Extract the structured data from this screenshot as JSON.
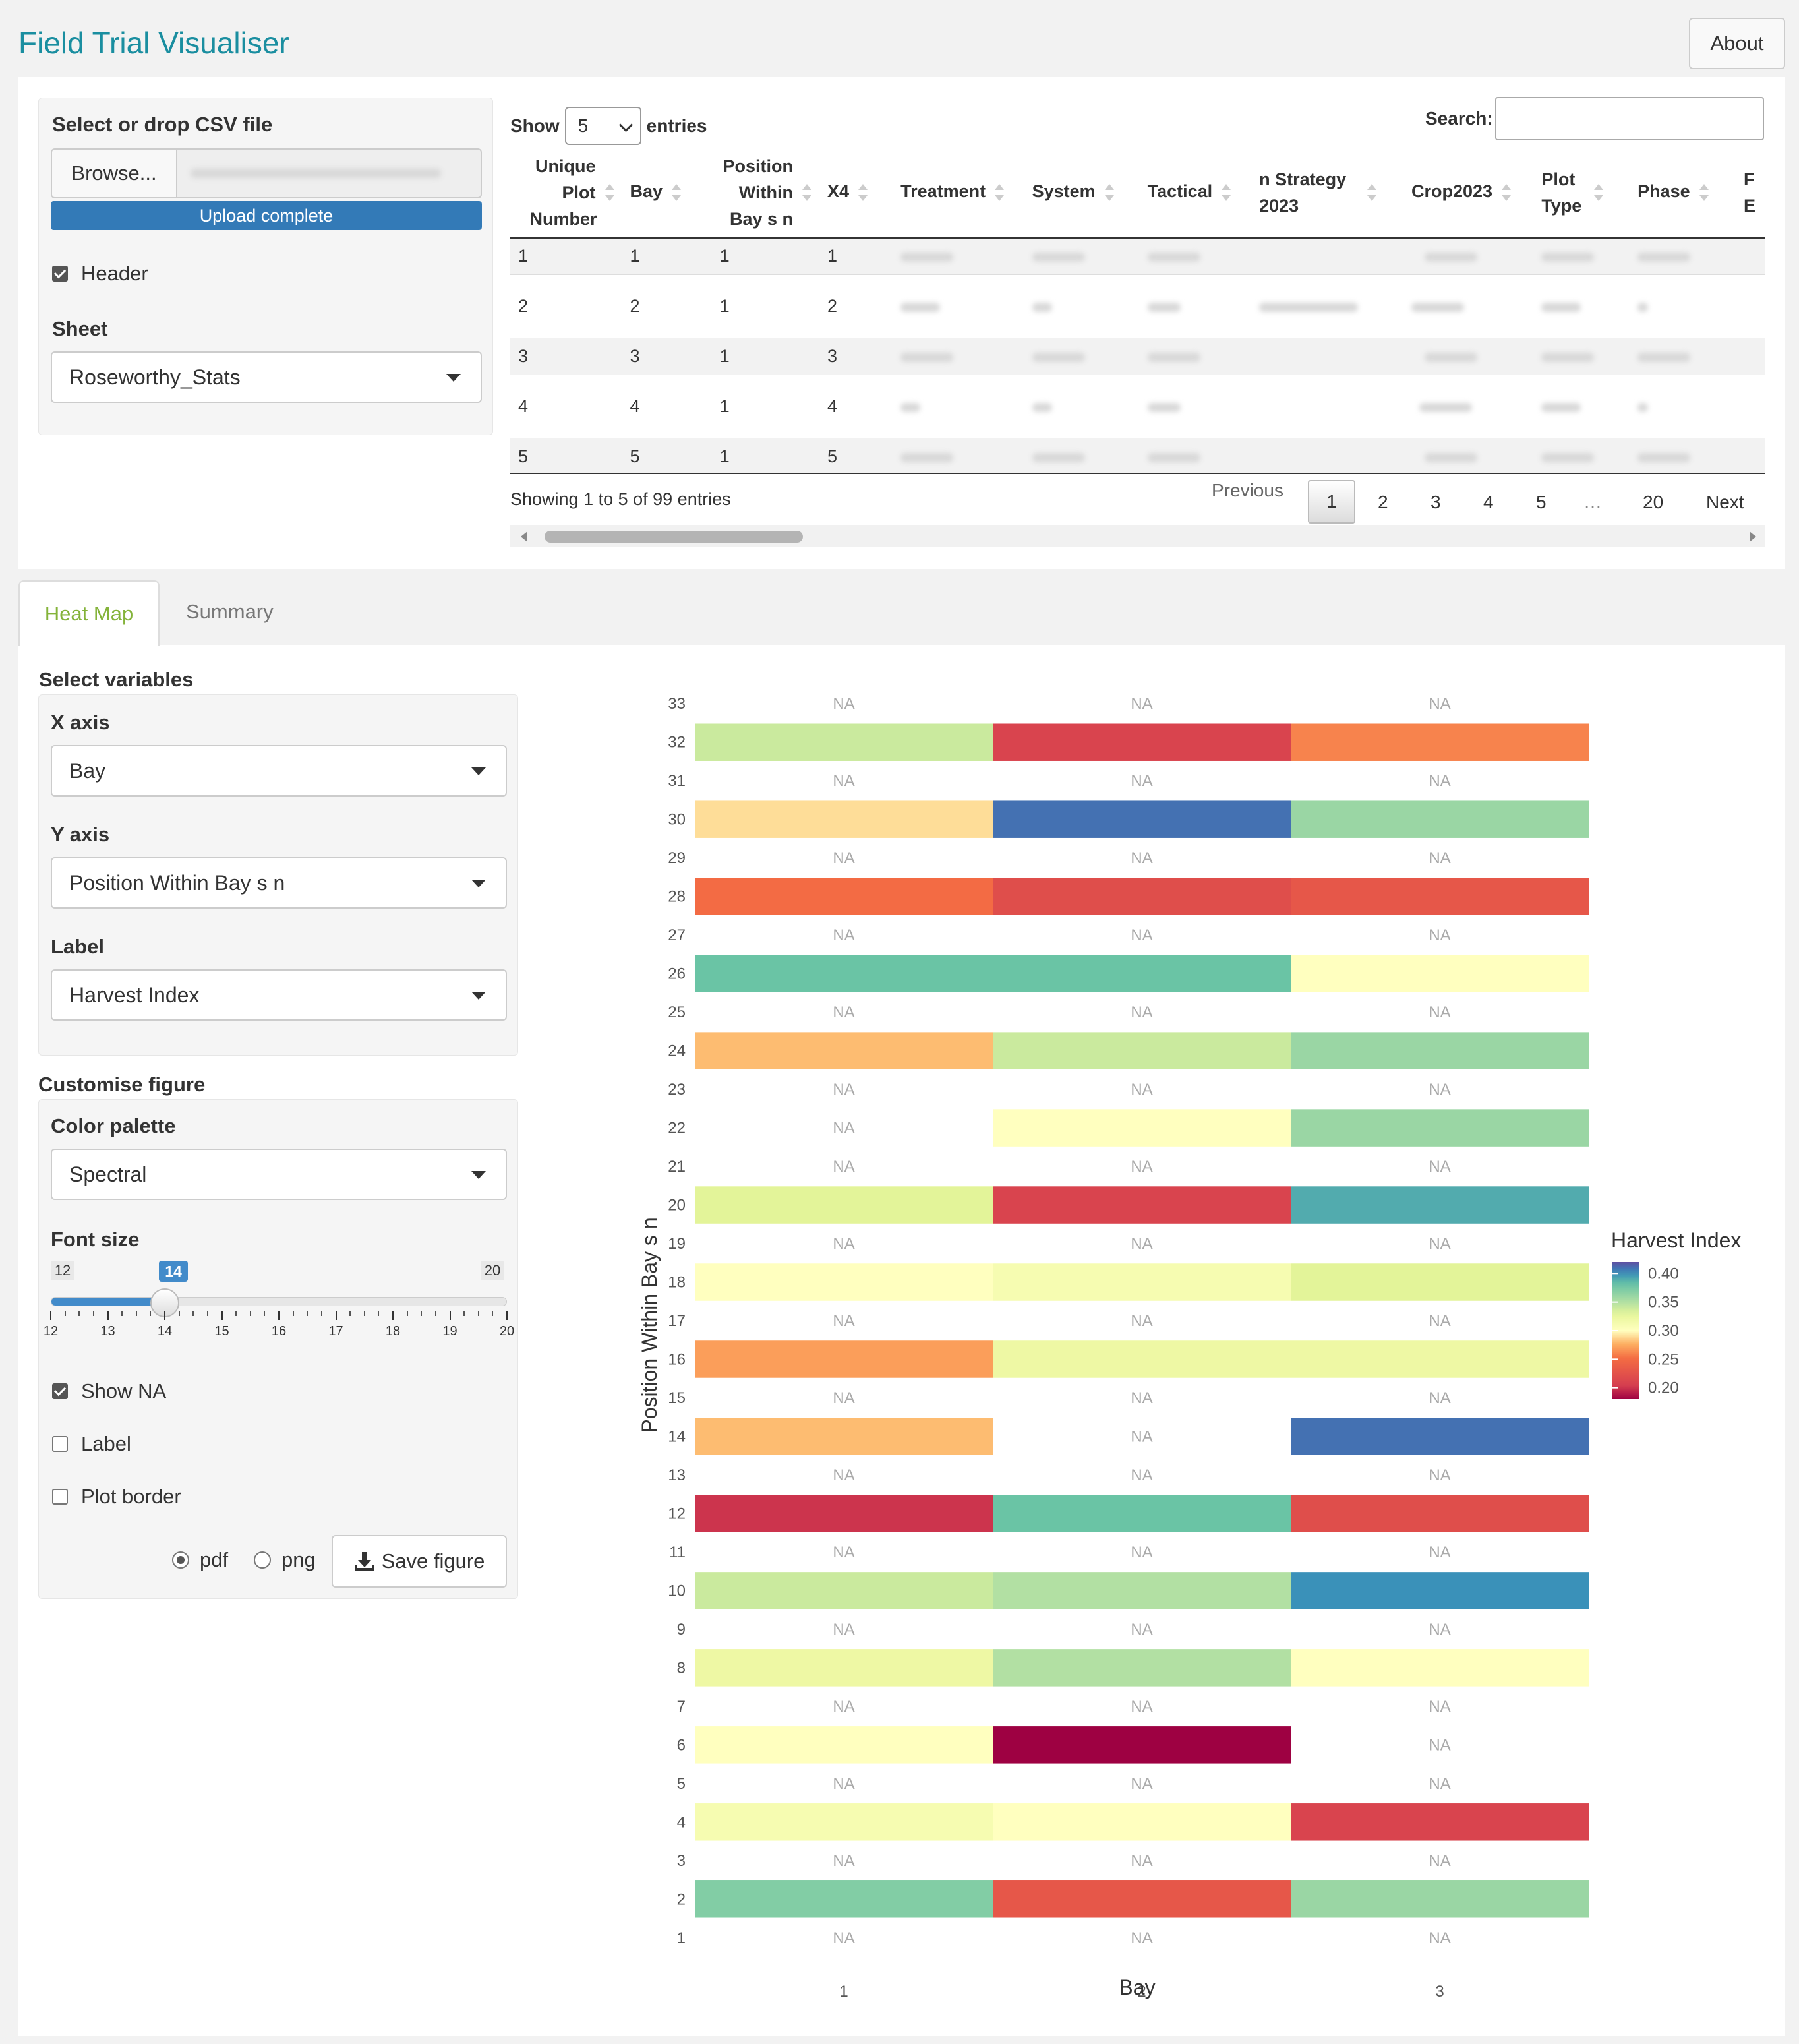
{
  "app": {
    "title": "Field Trial Visualiser",
    "about_label": "About"
  },
  "upload": {
    "label": "Select or drop CSV file",
    "browse_label": "Browse...",
    "progress_label": "Upload complete",
    "progress": 1.0,
    "header_label": "Header",
    "header_checked": true,
    "sheet_label": "Sheet",
    "sheet_value": "Roseworthy_Stats"
  },
  "table": {
    "show_label": "Show",
    "length_value": "5",
    "entries_label": "entries",
    "search_label": "Search:",
    "search_value": "",
    "columns": [
      "Unique Plot Number",
      "Bay",
      "Position Within Bay s n",
      "X4",
      "Treatment",
      "System",
      "Tactical",
      "n Strategy 2023",
      "Crop2023",
      "Plot Type",
      "Phase",
      "F E"
    ],
    "rows": [
      {
        "unique": "1",
        "bay": "1",
        "pos": "1",
        "x4": "1"
      },
      {
        "unique": "2",
        "bay": "2",
        "pos": "1",
        "x4": "2"
      },
      {
        "unique": "3",
        "bay": "3",
        "pos": "1",
        "x4": "3"
      },
      {
        "unique": "4",
        "bay": "4",
        "pos": "1",
        "x4": "4"
      },
      {
        "unique": "5",
        "bay": "5",
        "pos": "1",
        "x4": "5"
      }
    ],
    "info": "Showing 1 to 5 of 99 entries",
    "pagination": {
      "previous": "Previous",
      "pages": [
        "1",
        "2",
        "3",
        "4",
        "5",
        "…",
        "20"
      ],
      "current": "1",
      "next": "Next"
    }
  },
  "tabs": [
    {
      "label": "Heat Map",
      "active": true
    },
    {
      "label": "Summary",
      "active": false
    }
  ],
  "controls": {
    "select_variables_label": "Select variables",
    "x_axis_label": "X axis",
    "x_axis_value": "Bay",
    "y_axis_label": "Y axis",
    "y_axis_value": "Position Within Bay s n",
    "label_label": "Label",
    "label_value": "Harvest Index",
    "customise_label": "Customise figure",
    "palette_label": "Color palette",
    "palette_value": "Spectral",
    "font_size_label": "Font size",
    "font_size": {
      "min": "12",
      "max": "20",
      "value": "14",
      "ticks": [
        "12",
        "13",
        "14",
        "15",
        "16",
        "17",
        "18",
        "19",
        "20"
      ]
    },
    "show_na_label": "Show NA",
    "show_na_checked": true,
    "label_cb_label": "Label",
    "label_cb_checked": false,
    "plot_border_label": "Plot border",
    "plot_border_checked": false,
    "format_pdf": "pdf",
    "format_png": "png",
    "format_selected": "pdf",
    "save_label": "Save figure"
  },
  "chart_data": {
    "type": "heatmap",
    "xlabel": "Bay",
    "ylabel": "Position Within Bay s n",
    "x_categories": [
      "1",
      "2",
      "3"
    ],
    "y_categories": [
      "1",
      "2",
      "3",
      "4",
      "5",
      "6",
      "7",
      "8",
      "9",
      "10",
      "11",
      "12",
      "13",
      "14",
      "15",
      "16",
      "17",
      "18",
      "19",
      "20",
      "21",
      "22",
      "23",
      "24",
      "25",
      "26",
      "27",
      "28",
      "29",
      "30",
      "31",
      "32",
      "33"
    ],
    "na_label": "NA",
    "legend": {
      "title": "Harvest Index",
      "ticks": [
        "0.40",
        "0.35",
        "0.30",
        "0.25",
        "0.20"
      ],
      "range": [
        0.18,
        0.42
      ],
      "palette": "Spectral"
    },
    "cells": [
      {
        "y": "2",
        "values": [
          0.37,
          0.23,
          0.36
        ]
      },
      {
        "y": "4",
        "values": [
          0.31,
          0.3,
          0.21
        ]
      },
      {
        "y": "6",
        "values": [
          0.3,
          0.18,
          null
        ]
      },
      {
        "y": "8",
        "values": [
          0.32,
          0.35,
          0.3
        ]
      },
      {
        "y": "10",
        "values": [
          0.34,
          0.35,
          0.4
        ]
      },
      {
        "y": "12",
        "values": [
          0.2,
          0.38,
          0.22
        ]
      },
      {
        "y": "14",
        "values": [
          0.28,
          null,
          0.41
        ]
      },
      {
        "y": "16",
        "values": [
          0.27,
          0.32,
          0.32
        ]
      },
      {
        "y": "18",
        "values": [
          0.3,
          0.31,
          0.33
        ]
      },
      {
        "y": "20",
        "values": [
          0.33,
          0.21,
          0.39
        ]
      },
      {
        "y": "22",
        "values": [
          null,
          0.3,
          0.36
        ]
      },
      {
        "y": "24",
        "values": [
          0.28,
          0.34,
          0.36
        ]
      },
      {
        "y": "26",
        "values": [
          0.38,
          0.38,
          0.3
        ]
      },
      {
        "y": "28",
        "values": [
          0.25,
          0.22,
          0.23
        ]
      },
      {
        "y": "30",
        "values": [
          0.29,
          0.41,
          0.36
        ]
      },
      {
        "y": "32",
        "values": [
          0.34,
          0.21,
          0.26
        ]
      }
    ],
    "colors": {
      "title": "#1a8ea0",
      "tab_active": "#84b33a",
      "primary": "#337ab7"
    }
  }
}
